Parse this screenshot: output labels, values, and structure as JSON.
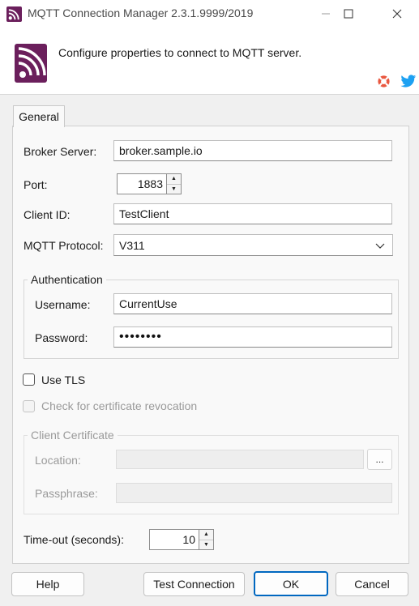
{
  "window": {
    "title": "MQTT Connection Manager 2.3.1.9999/2019"
  },
  "header": {
    "description": "Configure properties to connect to MQTT server."
  },
  "tabs": [
    {
      "label": "General"
    }
  ],
  "form": {
    "broker_server": {
      "label": "Broker Server:",
      "value": "broker.sample.io"
    },
    "port": {
      "label": "Port:",
      "value": "1883"
    },
    "client_id": {
      "label": "Client ID:",
      "value": "TestClient"
    },
    "mqtt_protocol": {
      "label": "MQTT Protocol:",
      "value": "V311"
    },
    "authentication": {
      "title": "Authentication",
      "username": {
        "label": "Username:",
        "value": "CurrentUse"
      },
      "password": {
        "label": "Password:",
        "value": "••••••••"
      }
    },
    "use_tls": {
      "label": "Use TLS",
      "checked": false
    },
    "check_revocation": {
      "label": "Check for certificate revocation",
      "checked": false,
      "enabled": false
    },
    "client_certificate": {
      "title": "Client Certificate",
      "location": {
        "label": "Location:",
        "value": "",
        "browse_label": "..."
      },
      "passphrase": {
        "label": "Passphrase:",
        "value": ""
      }
    },
    "timeout": {
      "label": "Time-out (seconds):",
      "value": "10"
    }
  },
  "buttons": {
    "help": "Help",
    "test_connection": "Test Connection",
    "ok": "OK",
    "cancel": "Cancel"
  },
  "colors": {
    "brand": "#6b1f5c",
    "accent": "#0067c0",
    "lifebuoy": "#e9573f",
    "twitter": "#1da1f2"
  }
}
